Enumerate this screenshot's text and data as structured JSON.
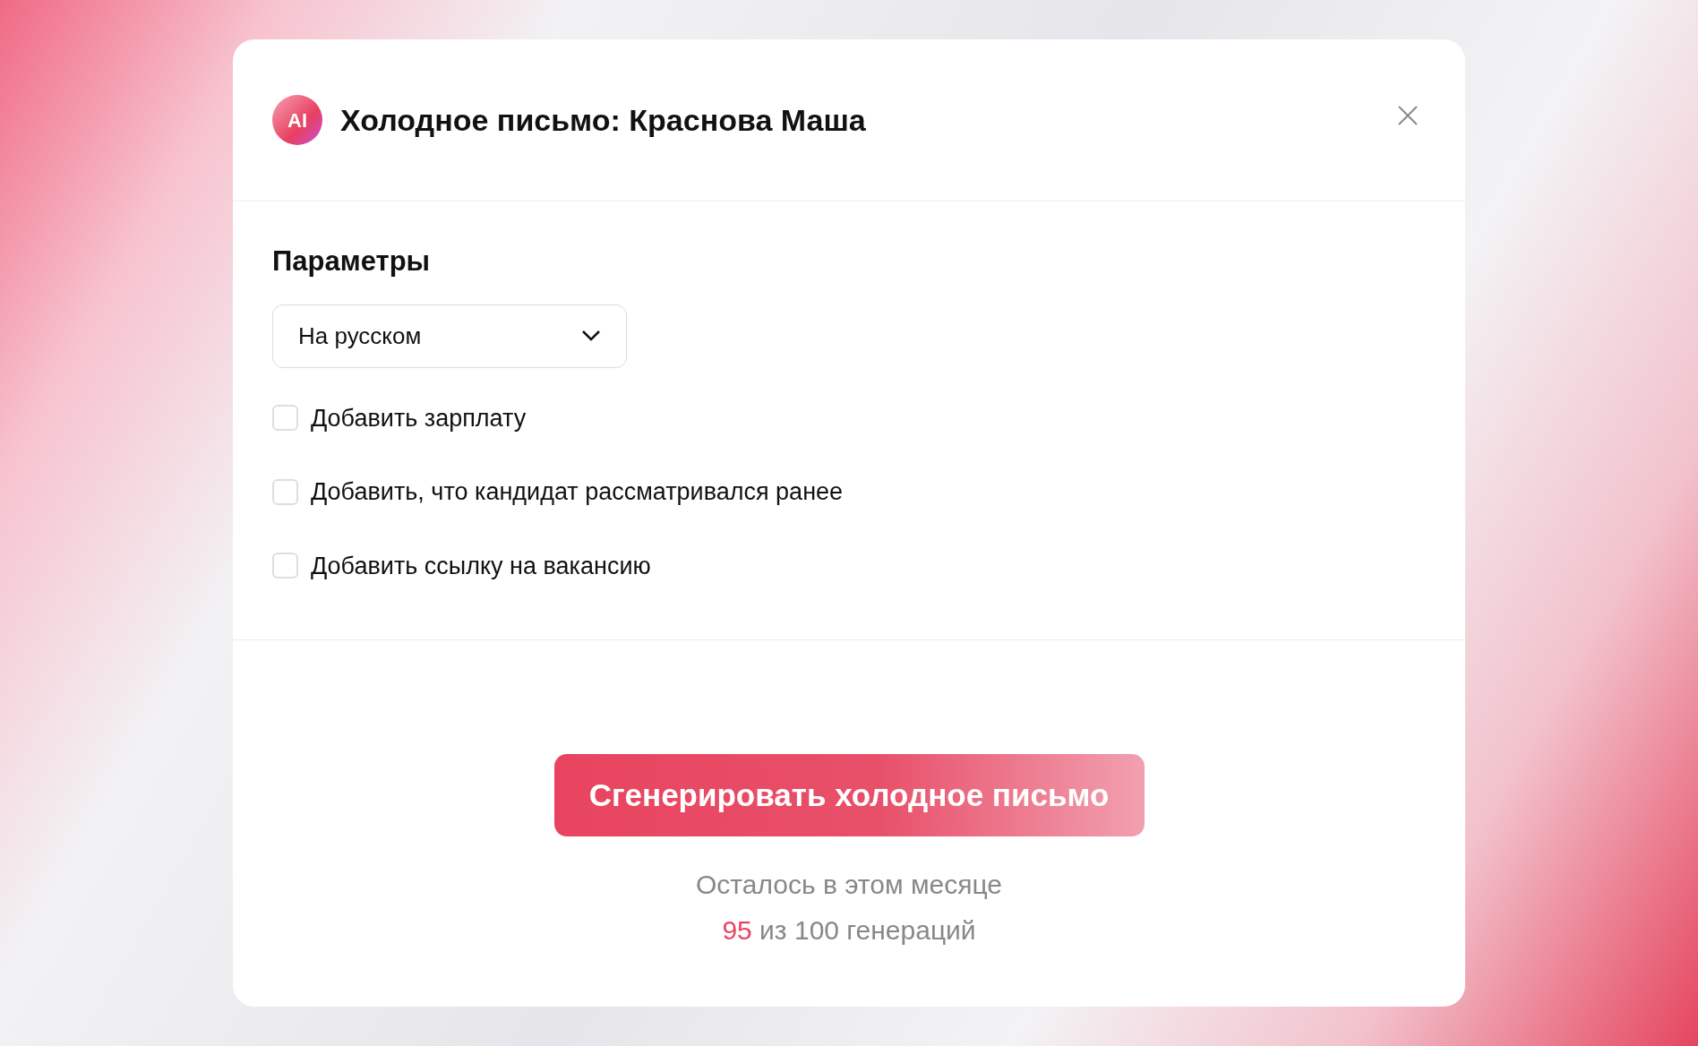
{
  "dialog": {
    "title": "Холодное письмо: Краснова Маша",
    "logo_text": "AI"
  },
  "parameters": {
    "heading": "Параметры",
    "language": "На русском",
    "options": [
      {
        "label": "Добавить зарплату",
        "checked": false
      },
      {
        "label": "Добавить, что кандидат рассматривался ранее",
        "checked": false
      },
      {
        "label": "Добавить ссылку на вакансию",
        "checked": false
      }
    ]
  },
  "generate_button": "Сгенерировать холодное письмо",
  "quota": {
    "line1": "Осталось в этом месяце",
    "count": "95",
    "rest": "из 100 генераций"
  }
}
